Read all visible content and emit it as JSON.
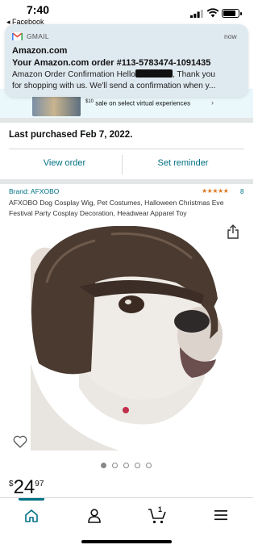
{
  "status_bar": {
    "time": "7:40",
    "back_app": "◂ Facebook",
    "battery_level": 0.85
  },
  "notification": {
    "app_name": "GMAIL",
    "time": "now",
    "sender": "Amazon.com",
    "subject": "Your Amazon.com order #113-5783474-1091435",
    "body_before": "Amazon Order Confirmation Hello",
    "body_after": ", Thank you",
    "body_line2": "for shopping with us. We'll send a confirmation when y..."
  },
  "promo": {
    "price_sup": "$10",
    "text": " sale on select virtual experiences",
    "chevron": "›"
  },
  "order": {
    "last_purchased": "Last purchased Feb 7, 2022.",
    "view_order": "View order",
    "set_reminder": "Set reminder"
  },
  "product": {
    "brand": "Brand: AFXOBO",
    "stars": "★★★★★",
    "rating_count": "8",
    "title": "AFXOBO Dog Cosplay Wig, Pet Costumes, Halloween Christmas Eve Festival Party Cosplay Decoration, Headwear Apparel Toy",
    "image_count": 5,
    "active_image": 0,
    "price_currency": "$",
    "price_whole": "24",
    "price_fraction": "97"
  },
  "bottom_nav": {
    "cart_count": "1",
    "items": [
      "home-icon",
      "account-icon",
      "cart-icon",
      "menu-icon"
    ]
  },
  "colors": {
    "link": "#007185",
    "star": "#de7921",
    "divider": "#e3e6e6"
  }
}
